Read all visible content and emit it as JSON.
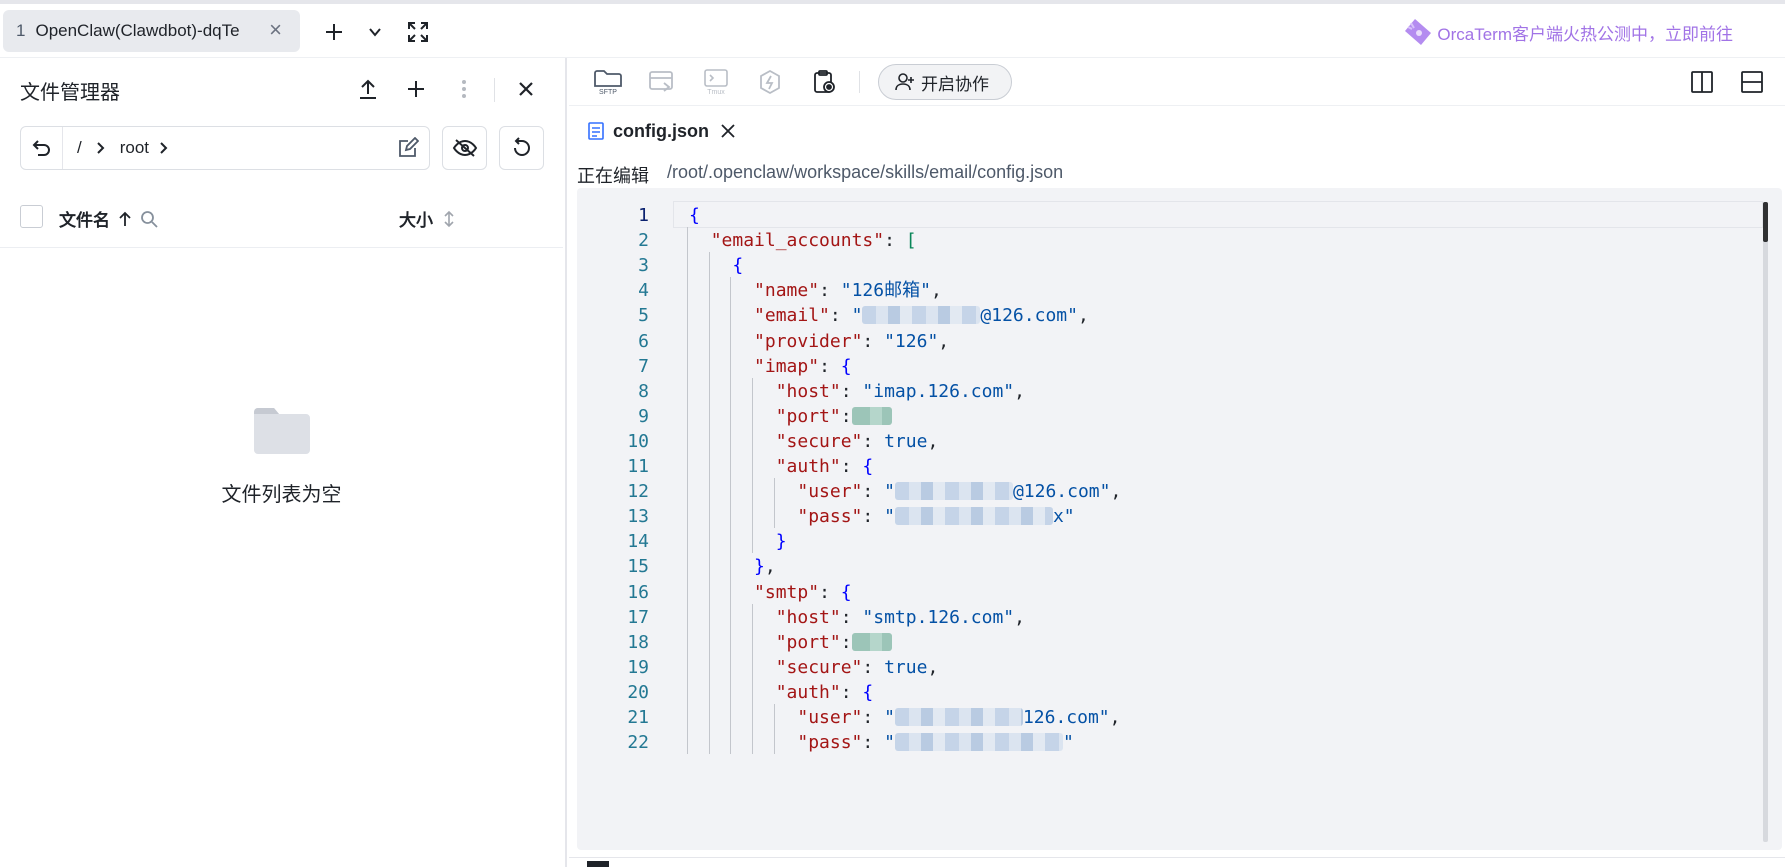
{
  "tab": {
    "number": "1",
    "title": "OpenClaw(Clawdbot)-dqTe"
  },
  "promo": {
    "text": "OrcaTerm客户端火热公测中，立即前往"
  },
  "file_manager": {
    "title": "文件管理器",
    "path_root": "/",
    "path_segment": "root",
    "col_name": "文件名",
    "col_size": "大小",
    "empty_text": "文件列表为空"
  },
  "toolbar": {
    "collab_label": "开启协作",
    "sftp_label": "SFTP",
    "tmux_label": "Tmux"
  },
  "editor": {
    "file_tab": "config.json",
    "editing_label": "正在编辑",
    "file_path": "/root/.openclaw/workspace/skills/email/config.json",
    "lines": [
      {
        "n": "1",
        "t": "{"
      },
      {
        "n": "2",
        "t": "  \"email_accounts\": ["
      },
      {
        "n": "3",
        "t": "    {"
      },
      {
        "n": "4",
        "t": "      \"name\": \"126邮箱\","
      },
      {
        "n": "5",
        "t": "      \"email\": \"@126.com\","
      },
      {
        "n": "6",
        "t": "      \"provider\": \"126\","
      },
      {
        "n": "7",
        "t": "      \"imap\": {"
      },
      {
        "n": "8",
        "t": "        \"host\": \"imap.126.com\","
      },
      {
        "n": "9",
        "t": "        \"port\":"
      },
      {
        "n": "10",
        "t": "        \"secure\": true,"
      },
      {
        "n": "11",
        "t": "        \"auth\": {"
      },
      {
        "n": "12",
        "t": "          \"user\": \"@126.com\","
      },
      {
        "n": "13",
        "t": "          \"pass\": \"x\""
      },
      {
        "n": "14",
        "t": "        }"
      },
      {
        "n": "15",
        "t": "      },"
      },
      {
        "n": "16",
        "t": "      \"smtp\": {"
      },
      {
        "n": "17",
        "t": "        \"host\": \"smtp.126.com\","
      },
      {
        "n": "18",
        "t": "        \"port\":"
      },
      {
        "n": "19",
        "t": "        \"secure\": true,"
      },
      {
        "n": "20",
        "t": "        \"auth\": {"
      },
      {
        "n": "21",
        "t": "          \"user\": \"126.com\","
      },
      {
        "n": "22",
        "t": "          \"pass\": \"\""
      }
    ]
  },
  "colors": {
    "key": "#a31515",
    "string": "#0451a5",
    "brace": "#0000ff",
    "bracket": "#098658",
    "line_number": "#237893",
    "promo": "#a173e6"
  }
}
